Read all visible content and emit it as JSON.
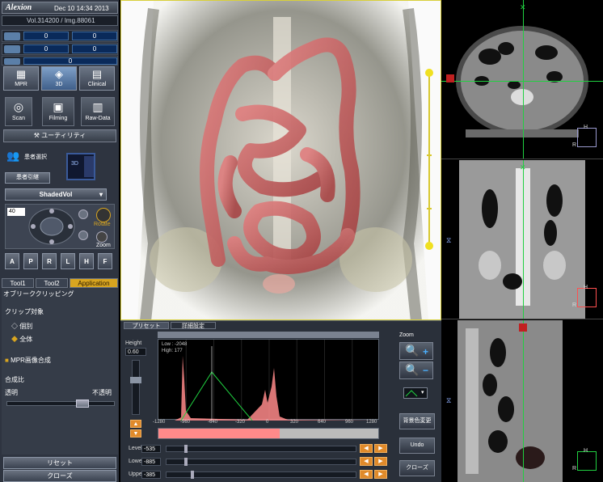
{
  "header": {
    "logo": "Alexion",
    "datetime": "Dec 10 14:34 2013"
  },
  "volume": {
    "text": "Vol.314200 / Img.88061"
  },
  "counters": [
    {
      "icon": "printer-icon",
      "a": "0",
      "b": "0"
    },
    {
      "icon": "disk-icon",
      "a": "0",
      "b": "0"
    },
    {
      "icon": "cd-icon",
      "a": "0"
    }
  ],
  "modes": [
    {
      "label": "MPR"
    },
    {
      "label": "3D"
    },
    {
      "label": "Clinical"
    }
  ],
  "actions": [
    {
      "label": "Scan"
    },
    {
      "label": "Filming"
    },
    {
      "label": "Raw-Data"
    }
  ],
  "utility": "ユーティリティ",
  "patient": {
    "select": "患者選択",
    "takeover": "患者引継",
    "mini": "3D"
  },
  "renderer": "ShadedVol",
  "rotate": {
    "angle": "40",
    "rotate_label": "Rotate",
    "zoom_label": "Zoom"
  },
  "orientations": [
    "A",
    "P",
    "R",
    "L",
    "H",
    "F"
  ],
  "tabs": [
    {
      "label": "Tool1"
    },
    {
      "label": "Tool2"
    },
    {
      "label": "Application"
    }
  ],
  "clipping": {
    "title": "オブリーククリッピング",
    "target_label": "クリップ対象",
    "opt_individual": "個別",
    "opt_all": "全体",
    "mpr_composite": "MPR画像合成",
    "ratio_label": "合成比",
    "transparent": "透明",
    "opaque": "不透明",
    "ratio_value": 0.72
  },
  "reset": "リセット",
  "close": "クローズ",
  "panel": {
    "tab_preset": "プリセット",
    "tab_detail": "詳細設定",
    "height_label": "Height",
    "height_value": "0.60",
    "low": "Low : -2048",
    "high": "High:  177",
    "zoom_label": "Zoom",
    "bgcolor": "背景色変更",
    "undo": "Undo",
    "close": "クローズ",
    "xticks": [
      "-1280",
      "-960",
      "-640",
      "-320",
      "0",
      "320",
      "640",
      "960",
      "1280"
    ],
    "level_label": "Level",
    "level_value": "-535",
    "lower_label": "Lower",
    "lower_value": "-885",
    "upper_label": "Upper",
    "upper_value": "-385",
    "arrow_left": "◀",
    "arrow_right": "▶"
  },
  "views": {
    "axial_label": "H",
    "axial_r": "R",
    "coronal_label": "H",
    "coronal_r": "R",
    "sagittal_label": "H",
    "sagittal_r": "R"
  },
  "colors": {
    "accent": "#d8a520",
    "histogram": "#ff8a8a",
    "bowel": "#c85a5a",
    "panel": "#2e3440"
  }
}
